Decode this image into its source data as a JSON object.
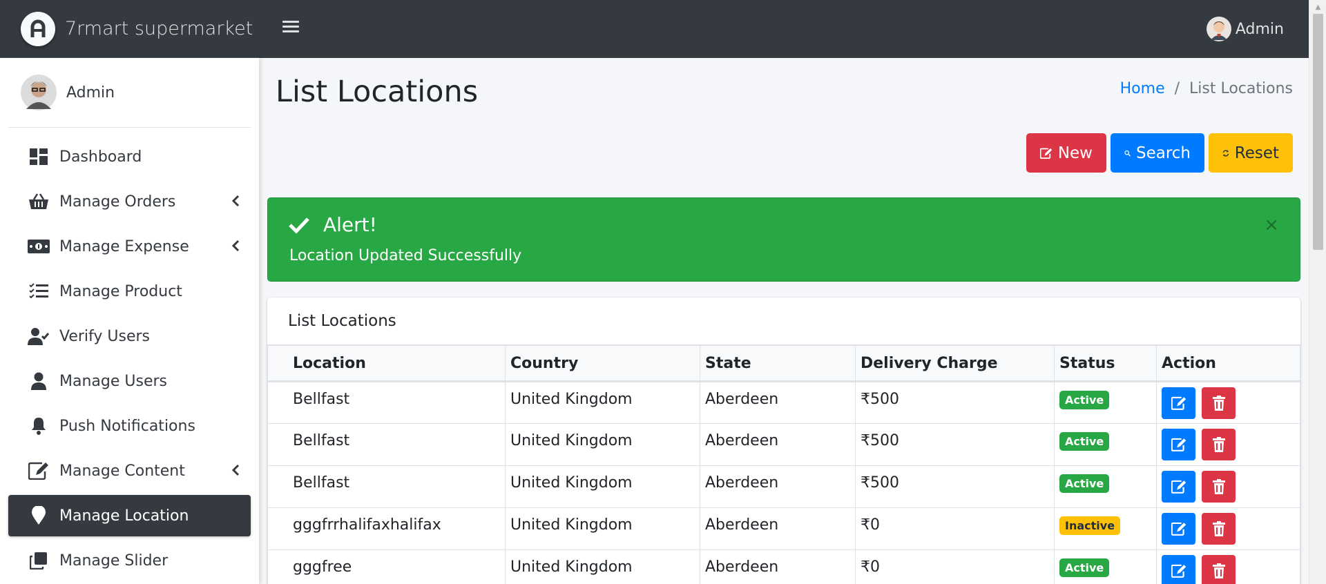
{
  "brand": {
    "name": "7rmart supermarket",
    "logo_icon": "brand-logo-a"
  },
  "topbar": {
    "user_name": "Admin"
  },
  "sidebar": {
    "user_name": "Admin",
    "items": [
      {
        "label": "Dashboard",
        "icon": "dashboard-icon",
        "submenu": false
      },
      {
        "label": "Manage Orders",
        "icon": "basket-icon",
        "submenu": true
      },
      {
        "label": "Manage Expense",
        "icon": "money-icon",
        "submenu": true
      },
      {
        "label": "Manage Product",
        "icon": "list-check-icon",
        "submenu": false
      },
      {
        "label": "Verify Users",
        "icon": "user-check-icon",
        "submenu": false
      },
      {
        "label": "Manage Users",
        "icon": "user-icon",
        "submenu": false
      },
      {
        "label": "Push Notifications",
        "icon": "bell-icon",
        "submenu": false
      },
      {
        "label": "Manage Content",
        "icon": "edit-icon",
        "submenu": true
      },
      {
        "label": "Manage Location",
        "icon": "map-marker-icon",
        "submenu": false,
        "active": true
      },
      {
        "label": "Manage Slider",
        "icon": "clone-icon",
        "submenu": false
      }
    ]
  },
  "page": {
    "title": "List Locations",
    "breadcrumb": {
      "home": "Home",
      "separator": "/",
      "current": "List Locations"
    }
  },
  "buttons": {
    "new": "New",
    "search": "Search",
    "reset": "Reset"
  },
  "alert": {
    "title": "Alert!",
    "message": "Location Updated Successfully",
    "close": "×"
  },
  "card": {
    "title": "List Locations"
  },
  "table": {
    "headers": {
      "location": "Location",
      "country": "Country",
      "state": "State",
      "charge": "Delivery Charge",
      "status": "Status",
      "action": "Action"
    },
    "rows": [
      {
        "location": "Bellfast",
        "country": "United Kingdom",
        "state": "Aberdeen",
        "charge": "₹500",
        "status": "Active"
      },
      {
        "location": "Bellfast",
        "country": "United Kingdom",
        "state": "Aberdeen",
        "charge": "₹500",
        "status": "Active"
      },
      {
        "location": "Bellfast",
        "country": "United Kingdom",
        "state": "Aberdeen",
        "charge": "₹500",
        "status": "Active"
      },
      {
        "location": "gggfrrhalifaxhalifax",
        "country": "United Kingdom",
        "state": "Aberdeen",
        "charge": "₹0",
        "status": "Inactive"
      },
      {
        "location": "gggfree",
        "country": "United Kingdom",
        "state": "Aberdeen",
        "charge": "₹0",
        "status": "Active"
      }
    ]
  },
  "colors": {
    "topbar": "#343a40",
    "danger": "#dc3545",
    "primary": "#007bff",
    "warning": "#ffc107",
    "success": "#28a745"
  }
}
